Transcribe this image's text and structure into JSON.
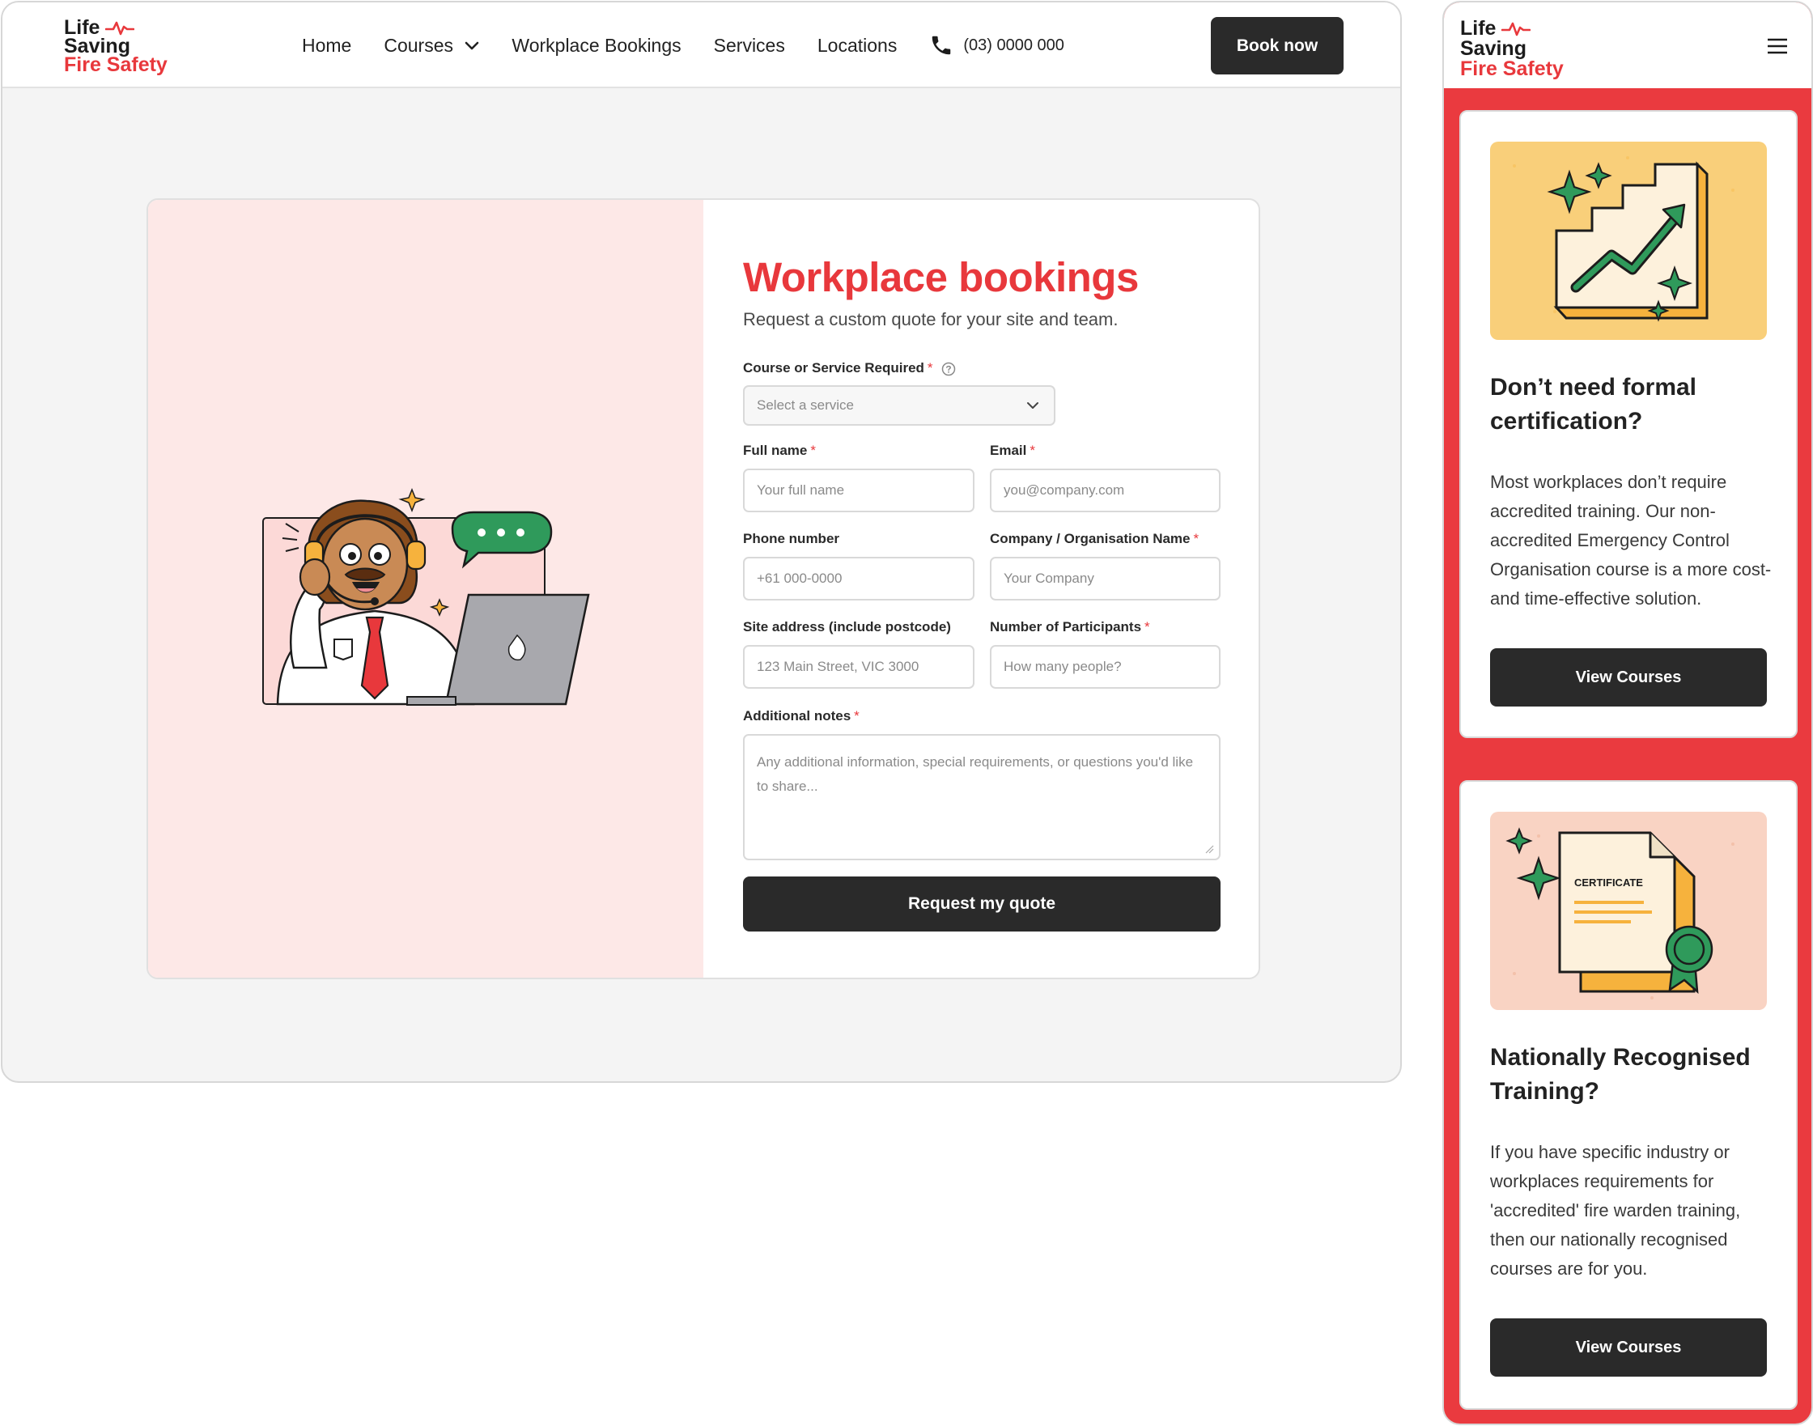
{
  "brand": {
    "line1": "Life",
    "line2": "Saving",
    "line3": "Fire Safety",
    "accent": "#e8383c"
  },
  "nav": {
    "items": [
      "Home",
      "Courses",
      "Workplace Bookings",
      "Services",
      "Locations"
    ],
    "phone": "(03) 0000 000",
    "cta": "Book now"
  },
  "form": {
    "title": "Workplace bookings",
    "subtitle": "Request a custom quote for your site and team.",
    "service_label": "Course or Service Required",
    "service_placeholder": "Select a service",
    "fullname_label": "Full name",
    "fullname_placeholder": "Your full name",
    "email_label": "Email",
    "email_placeholder": "you@company.com",
    "phone_label": "Phone number",
    "phone_placeholder": "+61 000-0000",
    "company_label": "Company / Organisation Name",
    "company_placeholder": "Your Company",
    "address_label": "Site address (include postcode)",
    "address_placeholder": "123 Main Street, VIC 3000",
    "participants_label": "Number of Participants",
    "participants_placeholder": "How many people?",
    "notes_label": "Additional notes",
    "notes_placeholder": "Any additional information, special requirements, or questions you'd like to share...",
    "required_mark": "*",
    "submit": "Request my quote"
  },
  "mobile": {
    "cards": [
      {
        "title": "Don’t need formal certification?",
        "text": "Most workplaces don’t require accredited training. Our non-accredited Emergency Control Organisation course is a more cost- and time-effective solution.",
        "button": "View Courses"
      },
      {
        "title": "Nationally Recognised Training?",
        "text": "If you have specific industry or workplaces  requirements for 'accredited' fire warden training, then our nationally recognised courses are for you.",
        "button": "View Courses",
        "certificate_label": "CERTIFICATE"
      }
    ]
  },
  "icons": [
    "pulse-icon",
    "chevron-down-icon",
    "phone-icon",
    "help-icon",
    "menu-icon",
    "resize-grip-icon"
  ]
}
